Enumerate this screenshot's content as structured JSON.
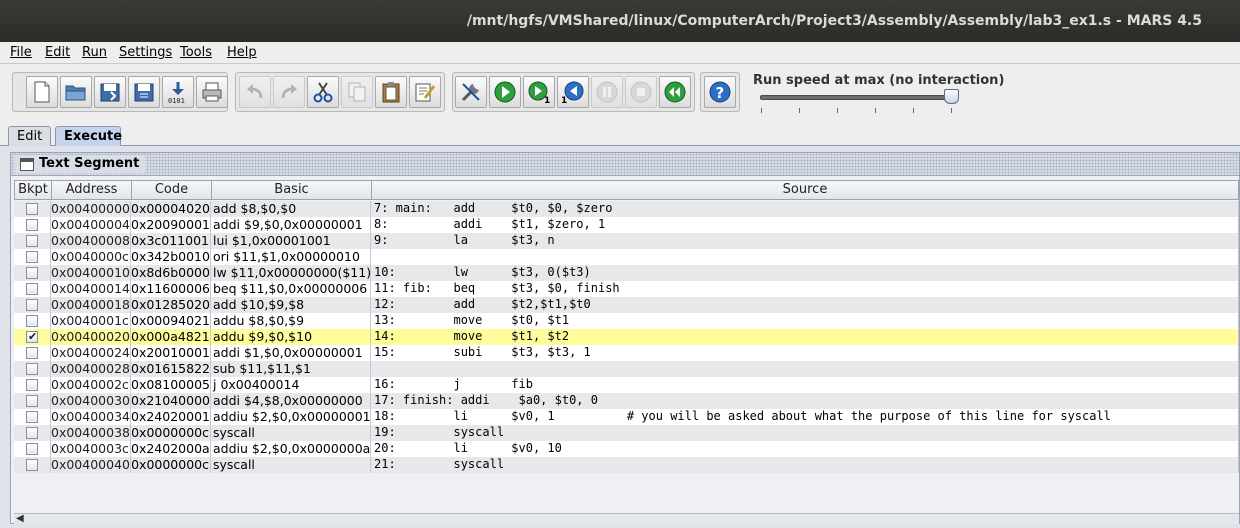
{
  "window": {
    "title": "/mnt/hgfs/VMShared/linux/ComputerArch/Project3/Assembly/Assembly/lab3_ex1.s  - MARS 4.5"
  },
  "menu": [
    {
      "label": "File",
      "accel": "F"
    },
    {
      "label": "Edit",
      "accel": "E"
    },
    {
      "label": "Run",
      "accel": "R"
    },
    {
      "label": "Settings",
      "accel": "S"
    },
    {
      "label": "Tools",
      "accel": "T"
    },
    {
      "label": "Help",
      "accel": "H"
    }
  ],
  "toolbar": {
    "file_buttons": [
      "new-file-icon",
      "open-folder-icon",
      "save-icon",
      "save-as-icon",
      "dump-memory-icon",
      "print-icon"
    ],
    "edit_buttons": [
      "undo-icon",
      "redo-icon",
      "cut-icon",
      "copy-icon",
      "paste-icon",
      "find-replace-icon"
    ],
    "run_buttons": [
      "assemble-icon",
      "run-icon",
      "step-icon",
      "backstep-icon",
      "pause-icon",
      "stop-icon",
      "reset-icon"
    ],
    "help_button": "help-icon",
    "speed_label": "Run speed at max (no interaction)",
    "speed_level": 1.0
  },
  "tabs": [
    {
      "label": "Edit",
      "active": false
    },
    {
      "label": "Execute",
      "active": true
    }
  ],
  "segment": {
    "title": "Text Segment",
    "columns": [
      "Bkpt",
      "Address",
      "Code",
      "Basic",
      "Source"
    ],
    "highlight_color": "#fffc9c",
    "rows": [
      {
        "bkpt": false,
        "address": "0x00400000",
        "code": "0x00004020",
        "basic": "add $8,$0,$0",
        "source": "7: main:   add     $t0, $0, $zero",
        "highlight": false
      },
      {
        "bkpt": false,
        "address": "0x00400004",
        "code": "0x20090001",
        "basic": "addi $9,$0,0x00000001",
        "source": "8:         addi    $t1, $zero, 1",
        "highlight": false
      },
      {
        "bkpt": false,
        "address": "0x00400008",
        "code": "0x3c011001",
        "basic": "lui $1,0x00001001",
        "source": "9:         la      $t3, n",
        "highlight": false
      },
      {
        "bkpt": false,
        "address": "0x0040000c",
        "code": "0x342b0010",
        "basic": "ori $11,$1,0x00000010",
        "source": "",
        "highlight": false
      },
      {
        "bkpt": false,
        "address": "0x00400010",
        "code": "0x8d6b0000",
        "basic": "lw $11,0x00000000($11)",
        "source": "10:        lw      $t3, 0($t3)",
        "highlight": false
      },
      {
        "bkpt": false,
        "address": "0x00400014",
        "code": "0x11600006",
        "basic": "beq $11,$0,0x00000006",
        "source": "11: fib:   beq     $t3, $0, finish",
        "highlight": false
      },
      {
        "bkpt": false,
        "address": "0x00400018",
        "code": "0x01285020",
        "basic": "add $10,$9,$8",
        "source": "12:        add     $t2,$t1,$t0",
        "highlight": false
      },
      {
        "bkpt": false,
        "address": "0x0040001c",
        "code": "0x00094021",
        "basic": "addu $8,$0,$9",
        "source": "13:        move    $t0, $t1",
        "highlight": false
      },
      {
        "bkpt": true,
        "address": "0x00400020",
        "code": "0x000a4821",
        "basic": "addu $9,$0,$10",
        "source": "14:        move    $t1, $t2",
        "highlight": true
      },
      {
        "bkpt": false,
        "address": "0x00400024",
        "code": "0x20010001",
        "basic": "addi $1,$0,0x00000001",
        "source": "15:        subi    $t3, $t3, 1",
        "highlight": false
      },
      {
        "bkpt": false,
        "address": "0x00400028",
        "code": "0x01615822",
        "basic": "sub $11,$11,$1",
        "source": "",
        "highlight": false
      },
      {
        "bkpt": false,
        "address": "0x0040002c",
        "code": "0x08100005",
        "basic": "j 0x00400014",
        "source": "16:        j       fib",
        "highlight": false
      },
      {
        "bkpt": false,
        "address": "0x00400030",
        "code": "0x21040000",
        "basic": "addi $4,$8,0x00000000",
        "source": "17: finish: addi    $a0, $t0, 0",
        "highlight": false
      },
      {
        "bkpt": false,
        "address": "0x00400034",
        "code": "0x24020001",
        "basic": "addiu $2,$0,0x00000001",
        "source": "18:        li      $v0, 1          # you will be asked about what the purpose of this line for syscall",
        "highlight": false
      },
      {
        "bkpt": false,
        "address": "0x00400038",
        "code": "0x0000000c",
        "basic": "syscall",
        "source": "19:        syscall",
        "highlight": false
      },
      {
        "bkpt": false,
        "address": "0x0040003c",
        "code": "0x2402000a",
        "basic": "addiu $2,$0,0x0000000a",
        "source": "20:        li      $v0, 10",
        "highlight": false
      },
      {
        "bkpt": false,
        "address": "0x00400040",
        "code": "0x0000000c",
        "basic": "syscall",
        "source": "21:        syscall",
        "highlight": false
      }
    ]
  }
}
